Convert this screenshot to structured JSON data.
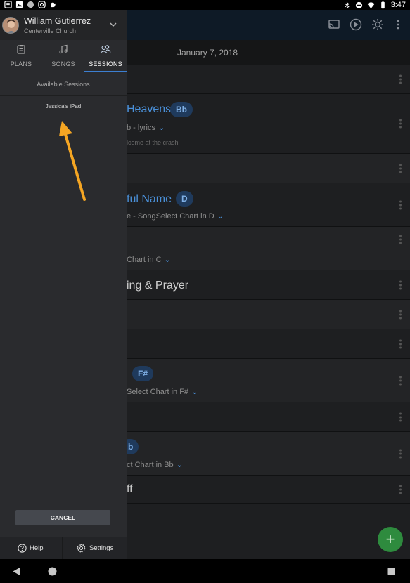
{
  "status_bar": {
    "time": "3:47",
    "left_icons": [
      "notes-icon",
      "image-icon",
      "circle-icon",
      "instagram-icon",
      "hand-icon"
    ],
    "right_icons": [
      "bluetooth-icon",
      "do-not-disturb-icon",
      "wifi-icon",
      "battery-icon"
    ]
  },
  "background_app": {
    "date": "January 7, 2018",
    "top_icons": [
      "cast-icon",
      "play-icon",
      "brightness-icon",
      "more-vert-icon"
    ],
    "items": [
      {
        "title": "Heavens",
        "key": "Bb",
        "subtitle": "lyrics",
        "note": "lcome at the crash"
      },
      {
        "title": "ful Name",
        "key": "D",
        "subtitle": "e - SongSelect Chart in D"
      },
      {
        "subtitle": "Chart in C"
      },
      {
        "title": "ing & Prayer"
      },
      {
        "key": "F#",
        "subtitle": "Select Chart in F#"
      },
      {
        "key": "b",
        "subtitle": "ct Chart in Bb"
      },
      {
        "title": "ff"
      }
    ],
    "fab_label": "+"
  },
  "drawer": {
    "user": {
      "name": "William Gutierrez",
      "organization": "Centerville Church"
    },
    "tabs": [
      {
        "label": "PLANS",
        "icon": "clipboard-icon",
        "active": false
      },
      {
        "label": "SONGS",
        "icon": "music-note-icon",
        "active": false
      },
      {
        "label": "SESSIONS",
        "icon": "people-icon",
        "active": true
      }
    ],
    "sessions_heading": "Available Sessions",
    "sessions": [
      "Jessica's iPad"
    ],
    "cancel_label": "CANCEL",
    "footer": {
      "help_label": "Help",
      "settings_label": "Settings"
    },
    "accent_color": "#3c7fd1",
    "annotation_arrow_color": "#f5a623"
  }
}
